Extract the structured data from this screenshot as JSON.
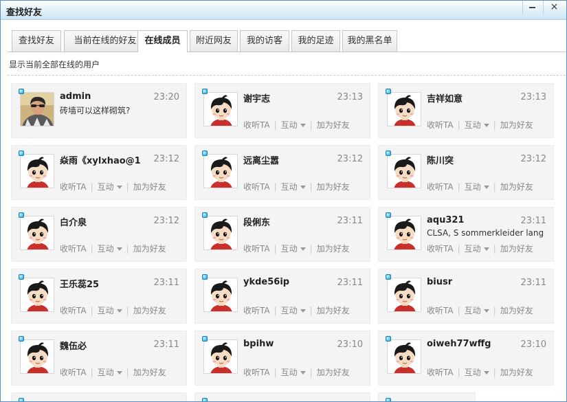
{
  "window": {
    "title": "查找好友",
    "minimize_icon": "minimize-icon",
    "close_icon": "close-icon",
    "close_glyph": "×"
  },
  "tabs": [
    {
      "label": "查找好友",
      "active": false
    },
    {
      "label": "当前在线的好友",
      "active": false
    },
    {
      "label": "在线成员",
      "active": true
    },
    {
      "label": "附近网友",
      "active": false
    },
    {
      "label": "我的访客",
      "active": false
    },
    {
      "label": "我的足迹",
      "active": false
    },
    {
      "label": "我的黑名单",
      "active": false
    }
  ],
  "subtitle": "显示当前全部在线的用户",
  "actions": {
    "listen": "收听TA",
    "interact": "互动",
    "add_friend": "加为好友"
  },
  "colors": {
    "accent": "#1aa0dc",
    "title_bar": "#cfe6f5",
    "card_bg": "#f4f4f4"
  },
  "members": [
    {
      "name": "admin",
      "time": "23:20",
      "message": "砖墙可以这样砌筑?",
      "avatar": "photo-avatar",
      "show_actions": false
    },
    {
      "name": "谢宇志",
      "time": "23:13",
      "message": "",
      "avatar": "default-avatar",
      "show_actions": true
    },
    {
      "name": "吉祥如意",
      "time": "23:13",
      "message": "",
      "avatar": "default-avatar",
      "show_actions": true
    },
    {
      "name": "焱雨《xylxhao@1",
      "time": "23:12",
      "message": "",
      "avatar": "default-avatar",
      "show_actions": true
    },
    {
      "name": "远离尘嚣",
      "time": "23:12",
      "message": "",
      "avatar": "default-avatar",
      "show_actions": true
    },
    {
      "name": "陈川突",
      "time": "23:12",
      "message": "",
      "avatar": "default-avatar",
      "show_actions": true
    },
    {
      "name": "白介泉",
      "time": "23:12",
      "message": "",
      "avatar": "default-avatar",
      "show_actions": true
    },
    {
      "name": "段俐东",
      "time": "23:11",
      "message": "",
      "avatar": "default-avatar",
      "show_actions": true
    },
    {
      "name": "aqu321",
      "time": "23:11",
      "message": "CLSA, S sommerkleider lang",
      "avatar": "default-avatar",
      "show_actions": true
    },
    {
      "name": "王乐蕊25",
      "time": "23:11",
      "message": "",
      "avatar": "default-avatar",
      "show_actions": true
    },
    {
      "name": "ykde56ip",
      "time": "23:11",
      "message": "",
      "avatar": "default-avatar",
      "show_actions": true
    },
    {
      "name": "biusr",
      "time": "23:11",
      "message": "",
      "avatar": "default-avatar",
      "show_actions": true
    },
    {
      "name": "魏伍必",
      "time": "23:11",
      "message": "",
      "avatar": "default-avatar",
      "show_actions": true
    },
    {
      "name": "bpihw",
      "time": "23:10",
      "message": "",
      "avatar": "default-avatar",
      "show_actions": true
    },
    {
      "name": "oiweh77wffg",
      "time": "23:10",
      "message": "",
      "avatar": "default-avatar",
      "show_actions": true
    }
  ]
}
